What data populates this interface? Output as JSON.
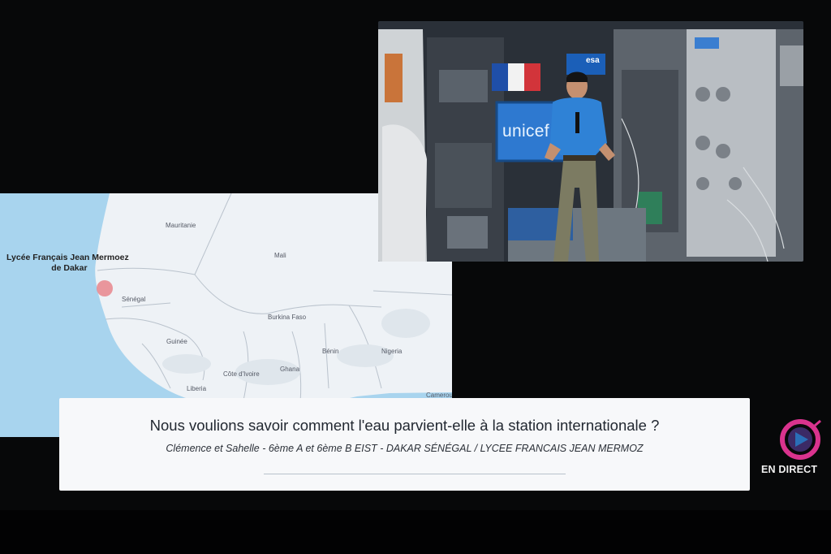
{
  "map": {
    "school_name": "Lycée Français Jean Mermoez",
    "school_city": "de Dakar",
    "labels": [
      "Mauritanie",
      "Mali",
      "Sénégal",
      "Burkina Faso",
      "Nigeria",
      "Ghana",
      "Côte d'Ivoire",
      "Liberia",
      "Guinée",
      "Bénin",
      "Cameroun"
    ]
  },
  "video": {
    "screen_text": "unicef",
    "patch_text": "esa"
  },
  "caption": {
    "question": "Nous voulions savoir comment l'eau parvient-elle à la station internationale ?",
    "credit": "Clémence et Sahelle - 6ème A et 6ème B EIST - DAKAR SÉNÉGAL / LYCEE FRANCAIS JEAN MERMOZ"
  },
  "live": {
    "label": "EN DIRECT"
  },
  "colors": {
    "ocean": "#a8d4ee",
    "land": "#eef2f6",
    "school_dot": "#e8868c",
    "live_ring": "#d9338e",
    "live_play": "#2a6fb8"
  }
}
